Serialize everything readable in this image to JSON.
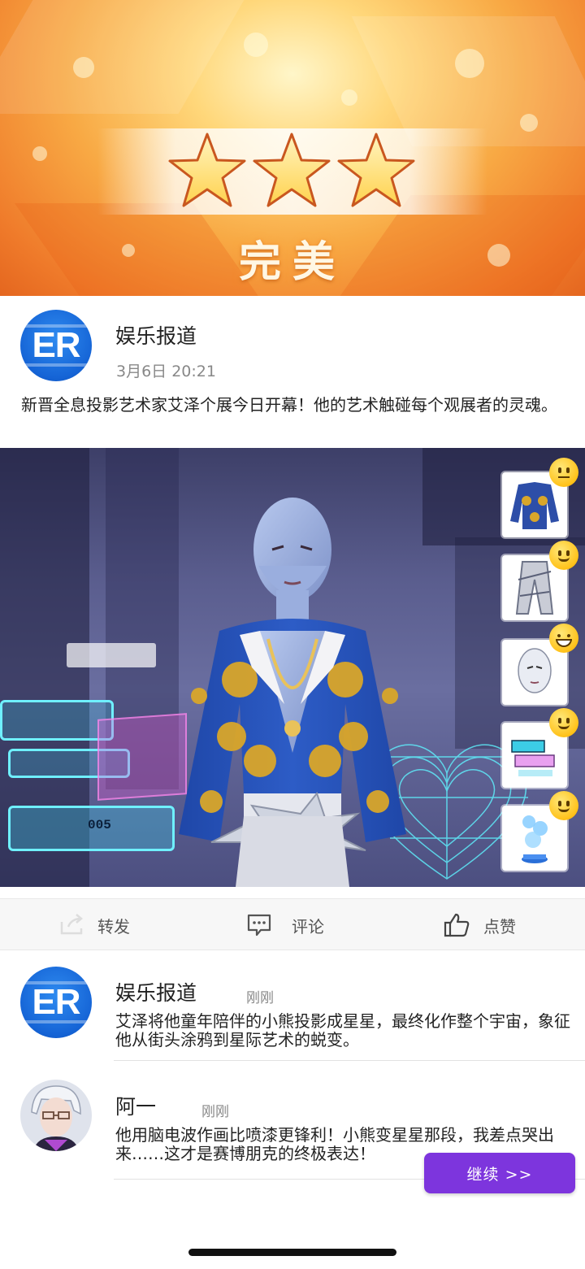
{
  "result": {
    "stars": 3,
    "star_total": 3,
    "rating_label": "完美"
  },
  "post": {
    "avatar_text": "ER",
    "author": "娱乐报道",
    "time": "3月6日 20:21",
    "text": "新晋全息投影艺术家艾泽个展今日开幕！他的艺术触碰每个观展者的灵魂。",
    "image_overlay_text": "005"
  },
  "outfit_items": [
    {
      "name": "jacket",
      "reaction": "neutral-face"
    },
    {
      "name": "pants",
      "reaction": "smile-face"
    },
    {
      "name": "face",
      "reaction": "grin-face"
    },
    {
      "name": "holo-screen",
      "reaction": "smile-face"
    },
    {
      "name": "holo-bear",
      "reaction": "smile-face"
    }
  ],
  "actions": {
    "share_label": "转发",
    "comment_label": "评论",
    "like_label": "点赞"
  },
  "comments": [
    {
      "avatar_text": "ER",
      "author": "娱乐报道",
      "time": "刚刚",
      "text": "艾泽将他童年陪伴的小熊投影成星星，最终化作整个宇宙，象征他从街头涂鸦到星际艺术的蜕变。"
    },
    {
      "author": "阿一",
      "time": "刚刚",
      "text": "他用脑电波作画比喷漆更锋利！小熊变星星那段，我差点哭出来……这才是赛博朋克的终极表达！"
    }
  ],
  "continue_label": "继续 >>",
  "colors": {
    "accent": "#7d35dd",
    "banner_orange": "#f8a944",
    "avatar_blue": "#1564d6"
  }
}
